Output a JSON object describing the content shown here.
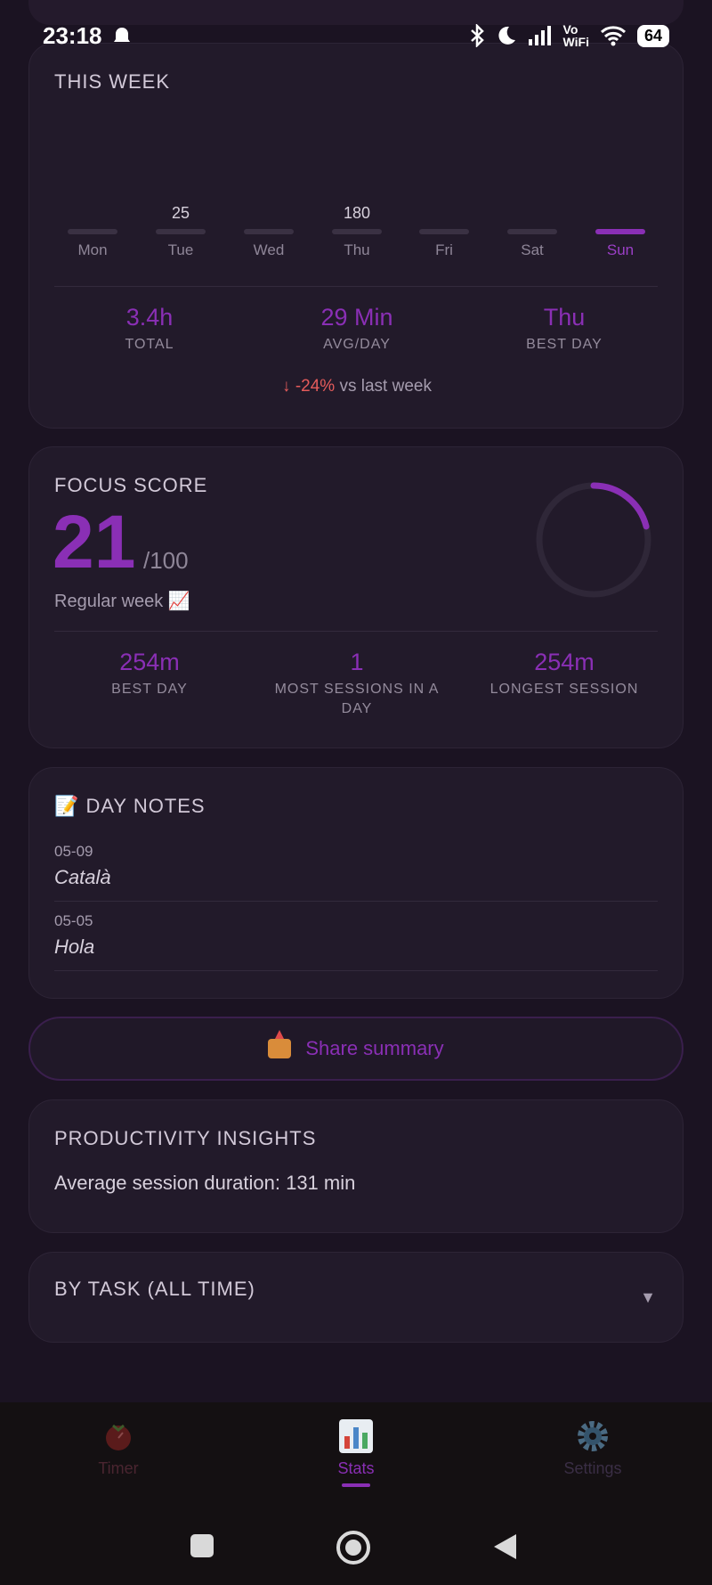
{
  "status": {
    "time": "23:18",
    "battery": "64",
    "vowifi_top": "Vo",
    "vowifi_bottom": "WiFi"
  },
  "week": {
    "title": "THIS WEEK",
    "days": [
      {
        "label": "Mon",
        "value": ""
      },
      {
        "label": "Tue",
        "value": "25"
      },
      {
        "label": "Wed",
        "value": ""
      },
      {
        "label": "Thu",
        "value": "180"
      },
      {
        "label": "Fri",
        "value": ""
      },
      {
        "label": "Sat",
        "value": ""
      },
      {
        "label": "Sun",
        "value": ""
      }
    ],
    "total_value": "3.4h",
    "total_label": "TOTAL",
    "avg_value": "29 Min",
    "avg_label": "AVG/DAY",
    "best_value": "Thu",
    "best_label": "BEST DAY",
    "trend_arrow": "↓",
    "trend_pct": "-24%",
    "trend_text": "vs last week"
  },
  "focus": {
    "title": "FOCUS SCORE",
    "score": "21",
    "max": "/100",
    "description": "Regular week 📈",
    "progress": 0.21,
    "best_day_value": "254m",
    "best_day_label": "BEST DAY",
    "most_sessions_value": "1",
    "most_sessions_label": "MOST SESSIONS IN A DAY",
    "longest_value": "254m",
    "longest_label": "LONGEST SESSION"
  },
  "notes": {
    "title": "📝 DAY NOTES",
    "items": [
      {
        "date": "05-09",
        "text": "Català"
      },
      {
        "date": "05-05",
        "text": "Hola"
      }
    ]
  },
  "share": {
    "label": "Share summary"
  },
  "insights": {
    "title": "PRODUCTIVITY INSIGHTS",
    "text": "Average session duration: 131 min"
  },
  "by_task": {
    "title": "BY TASK (ALL TIME)",
    "chevron": "▼"
  },
  "nav": {
    "timer": "Timer",
    "stats": "Stats",
    "settings": "Settings"
  },
  "colors": {
    "accent": "#8a2fb5",
    "background": "#1b1322",
    "card": "#221a2a",
    "negative": "#e45b5b"
  }
}
